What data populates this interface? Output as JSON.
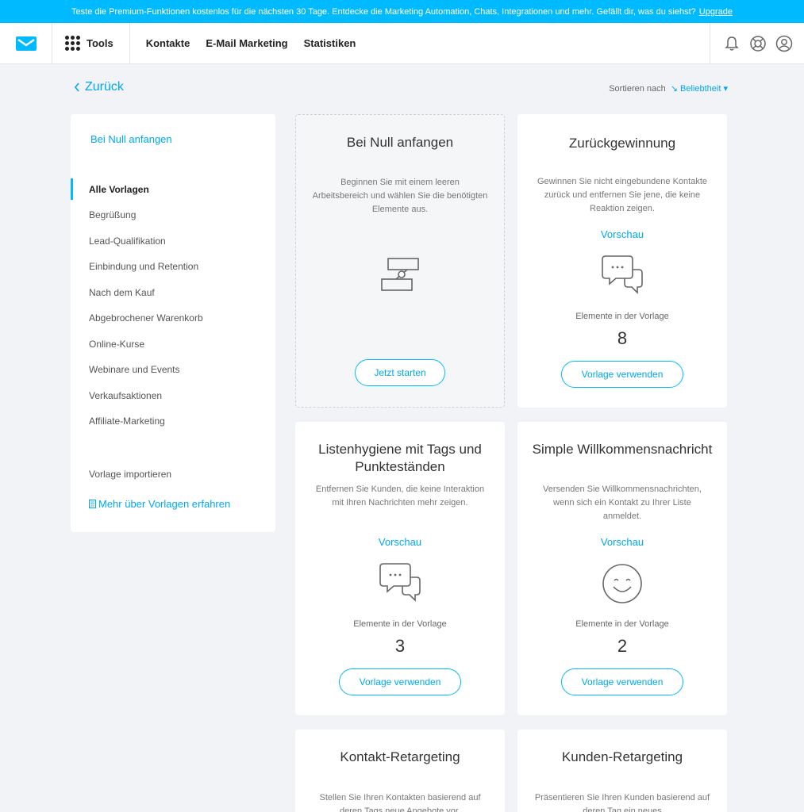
{
  "banner": {
    "text": "Teste die Premium-Funktionen kostenlos für die nächsten 30 Tage. Entdecke die Marketing Automation, Chats, Integrationen und mehr. Gefällt dir, was du siehst?",
    "link": "Upgrade"
  },
  "nav": {
    "tools": "Tools",
    "links": [
      "Kontakte",
      "E-Mail Marketing",
      "Statistiken"
    ]
  },
  "header": {
    "back": "Zurück",
    "sort_label": "Sortieren nach",
    "sort_value": "Beliebtheit"
  },
  "sidebar": {
    "start": "Bei Null anfangen",
    "categories": [
      "Alle Vorlagen",
      "Begrüßung",
      "Lead-Qualifikation",
      "Einbindung und Retention",
      "Nach dem Kauf",
      "Abgebrochener Warenkorb",
      "Online-Kurse",
      "Webinare und Events",
      "Verkaufsaktionen",
      "Affiliate-Marketing"
    ],
    "import": "Vorlage importieren",
    "more": "Mehr über Vorlagen erfahren"
  },
  "cards": [
    {
      "title": "Bei Null anfangen",
      "desc": "Beginnen Sie mit einem leeren Arbeitsbereich und wählen Sie die benötigten Elemente aus.",
      "button": "Jetzt starten",
      "icon": "workflow-icon"
    },
    {
      "title": "Zurückgewinnung",
      "desc": "Gewinnen Sie nicht eingebundene Kontakte zurück und entfernen Sie jene, die keine Reaktion zeigen.",
      "preview": "Vorschau",
      "icon": "chat-bubbles-icon",
      "elements_label": "Elemente in der Vorlage",
      "elements": "8",
      "button": "Vorlage verwenden"
    },
    {
      "title": "Listenhygiene mit Tags und Punkteständen",
      "desc": "Entfernen Sie Kunden, die keine Interaktion mit Ihren Nachrichten mehr zeigen.",
      "preview": "Vorschau",
      "icon": "chat-bubbles-icon",
      "elements_label": "Elemente in der Vorlage",
      "elements": "3",
      "button": "Vorlage verwenden"
    },
    {
      "title": "Simple Willkommensnachricht",
      "desc": "Versenden Sie Willkommensnachrichten, wenn sich ein Kontakt zu Ihrer Liste anmeldet.",
      "preview": "Vorschau",
      "icon": "smiley-icon",
      "elements_label": "Elemente in der Vorlage",
      "elements": "2",
      "button": "Vorlage verwenden"
    },
    {
      "title": "Kontakt-Retargeting",
      "desc": "Stellen Sie Ihren Kontakten basierend auf deren Tags neue Angebote vor."
    },
    {
      "title": "Kunden-Retargeting",
      "desc": "Präsentieren Sie Ihren Kunden basierend auf deren Tag ein neues"
    }
  ],
  "colors": {
    "accent": "#00baff",
    "link": "#00a8ef",
    "background": "#f1f3f6"
  }
}
